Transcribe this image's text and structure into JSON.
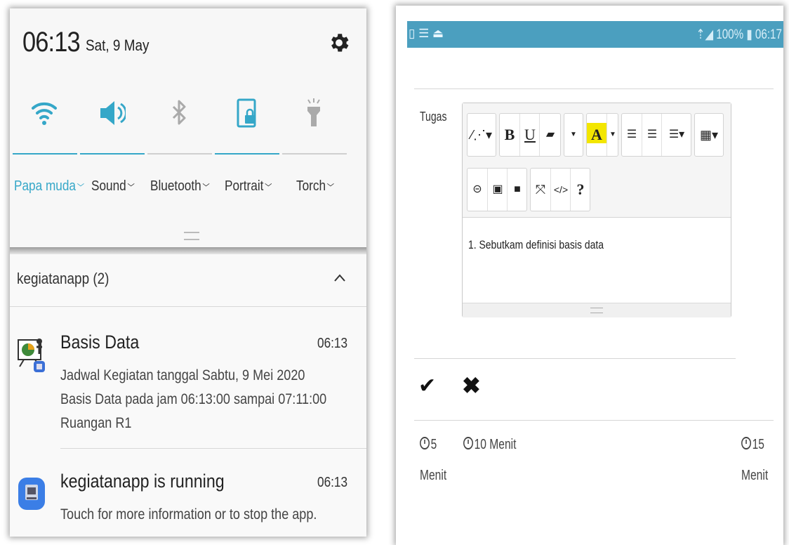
{
  "left": {
    "clock": "06:13",
    "date": "Sat, 9 May",
    "tiles": [
      {
        "label": "Papa muda",
        "icon": "wifi-icon",
        "active": true
      },
      {
        "label": "Sound",
        "icon": "speaker-icon",
        "active": true
      },
      {
        "label": "Bluetooth",
        "icon": "bluetooth-icon",
        "active": false
      },
      {
        "label": "Portrait",
        "icon": "rotation-lock-icon",
        "active": true
      },
      {
        "label": "Torch",
        "icon": "torch-icon",
        "active": false
      }
    ],
    "group": "kegiatanapp (2)",
    "notifications": [
      {
        "title": "Basis Data",
        "time": "06:13",
        "lines": [
          "Jadwal Kegiatan tanggal  Sabtu, 9 Mei 2020",
          "Basis Data pada jam 06:13:00 sampai 07:11:00",
          "Ruangan R1"
        ]
      },
      {
        "title": "kegiatanapp is running",
        "time": "06:13",
        "lines": [
          "Touch for more information or to stop the app."
        ]
      }
    ],
    "accent": "#35a7c8"
  },
  "right": {
    "status_right": "100% ▮ 06:17",
    "status_color": "#4b9fbf",
    "field_label": "Tugas",
    "toolbar": {
      "bold": "B",
      "underline": "U",
      "highlight": "A",
      "help": "?"
    },
    "content": "1. Sebutkam definisi basis data",
    "options": [
      {
        "line1": "5",
        "line2": "Menit"
      },
      {
        "line1": "10 Menit"
      },
      {
        "line1": "15",
        "line2": "Menit"
      }
    ]
  }
}
